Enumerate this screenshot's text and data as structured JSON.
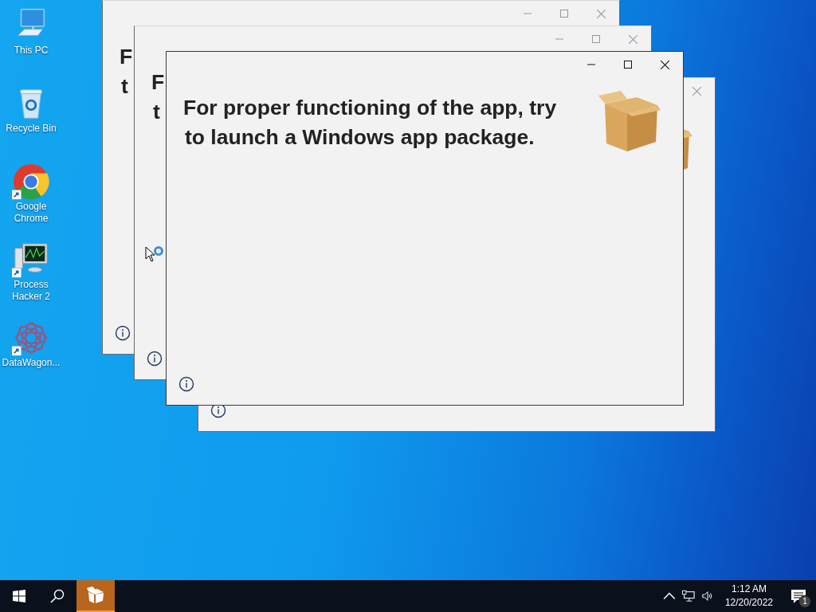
{
  "desktop_icons": [
    {
      "label": "This PC",
      "kind": "pc",
      "shortcut": false
    },
    {
      "label": "Recycle Bin",
      "kind": "bin",
      "shortcut": false
    },
    {
      "label": "Google Chrome",
      "kind": "chrome",
      "shortcut": true
    },
    {
      "label": "Process Hacker 2",
      "kind": "monitor",
      "shortcut": true
    },
    {
      "label": "DataWagon...",
      "kind": "flower",
      "shortcut": true
    }
  ],
  "windows": [
    {
      "active": false,
      "heading_lines": [
        "F",
        "t"
      ],
      "title_buttons": [
        {
          "kind": "minimize"
        },
        {
          "kind": "maximize"
        },
        {
          "kind": "close"
        }
      ],
      "package_icon": false
    },
    {
      "active": false,
      "heading_lines": [
        "F",
        "t"
      ],
      "title_buttons": [
        {
          "kind": "minimize"
        },
        {
          "kind": "maximize"
        },
        {
          "kind": "close"
        }
      ],
      "package_icon": false
    },
    {
      "active": false,
      "title_buttons": [
        {
          "kind": "close"
        }
      ],
      "package_icon": true
    },
    {
      "active": true,
      "heading_lines": [
        "For proper functioning of the app, try",
        "to launch a Windows app package."
      ],
      "title_buttons": [
        {
          "kind": "minimize"
        },
        {
          "kind": "maximize"
        },
        {
          "kind": "close"
        }
      ],
      "package_icon": true
    }
  ],
  "taskbar": {
    "apps": [
      {
        "kind": "package",
        "selected": true
      }
    ],
    "clock": {
      "time": "1:12 AM",
      "date": "12/20/2022"
    },
    "notification_count": "1"
  }
}
